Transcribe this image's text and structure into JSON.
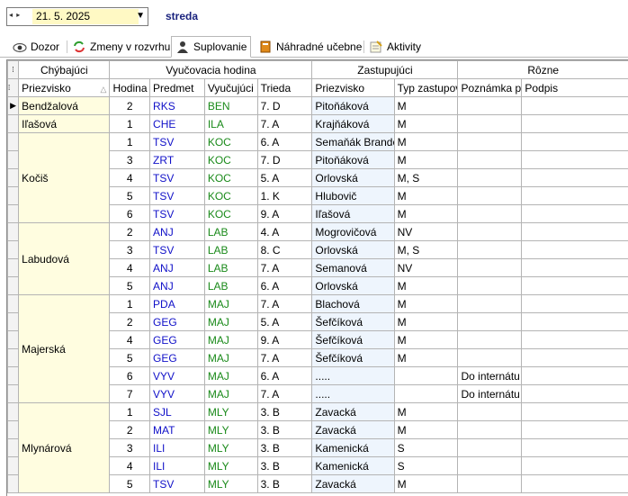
{
  "toolbar": {
    "nav_arrows": "◂ ▸",
    "date": "21. 5. 2025",
    "day_name": "streda"
  },
  "tabs": [
    {
      "label": "Dozor",
      "icon": "eye-icon"
    },
    {
      "label": "Zmeny v rozvrhu",
      "icon": "refresh-icon"
    },
    {
      "label": "Suplovanie",
      "icon": "person-icon"
    },
    {
      "label": "Náhradné učebne",
      "icon": "book-icon"
    },
    {
      "label": "Aktivity",
      "icon": "notepad-icon"
    }
  ],
  "active_tab": "Suplovanie",
  "grid": {
    "groups": [
      "Chýbajúci",
      "Vyučovacia hodina",
      "Zastupujúci",
      "Rôzne"
    ],
    "columns": [
      "Priezvisko",
      "Hodina",
      "Predmet",
      "Vyučujúci",
      "Trieda",
      "Priezvisko",
      "Typ zastupov",
      "Poznámka p",
      "Podpis"
    ],
    "teachers": [
      {
        "name": "Bendžalová",
        "rows": [
          {
            "hodina": "2",
            "predmet": "RKS",
            "vyucujuci": "BEN",
            "trieda": "7. D",
            "zastupujuci": "Pitoňáková",
            "typ": "M",
            "poznamka": "",
            "podpis": ""
          }
        ]
      },
      {
        "name": "Iľašová",
        "rows": [
          {
            "hodina": "1",
            "predmet": "CHE",
            "vyucujuci": "ILA",
            "trieda": "7. A",
            "zastupujuci": "Krajňáková",
            "typ": "M",
            "poznamka": "",
            "podpis": ""
          }
        ]
      },
      {
        "name": "Kočiš",
        "rows": [
          {
            "hodina": "1",
            "predmet": "TSV",
            "vyucujuci": "KOC",
            "trieda": "6. A",
            "zastupujuci": "Semaňák Brando",
            "typ": "M",
            "poznamka": "",
            "podpis": ""
          },
          {
            "hodina": "3",
            "predmet": "ZRT",
            "vyucujuci": "KOC",
            "trieda": "7. D",
            "zastupujuci": "Pitoňáková",
            "typ": "M",
            "poznamka": "",
            "podpis": ""
          },
          {
            "hodina": "4",
            "predmet": "TSV",
            "vyucujuci": "KOC",
            "trieda": "5. A",
            "zastupujuci": "Orlovská",
            "typ": "M, S",
            "poznamka": "",
            "podpis": ""
          },
          {
            "hodina": "5",
            "predmet": "TSV",
            "vyucujuci": "KOC",
            "trieda": "1. K",
            "zastupujuci": "Hlubovič",
            "typ": "M",
            "poznamka": "",
            "podpis": ""
          },
          {
            "hodina": "6",
            "predmet": "TSV",
            "vyucujuci": "KOC",
            "trieda": "9. A",
            "zastupujuci": "Iľašová",
            "typ": "M",
            "poznamka": "",
            "podpis": ""
          }
        ]
      },
      {
        "name": "Labudová",
        "rows": [
          {
            "hodina": "2",
            "predmet": "ANJ",
            "vyucujuci": "LAB",
            "trieda": "4. A",
            "zastupujuci": "Mogrovičová",
            "typ": "NV",
            "poznamka": "",
            "podpis": ""
          },
          {
            "hodina": "3",
            "predmet": "TSV",
            "vyucujuci": "LAB",
            "trieda": "8. C",
            "zastupujuci": "Orlovská",
            "typ": "M, S",
            "poznamka": "",
            "podpis": ""
          },
          {
            "hodina": "4",
            "predmet": "ANJ",
            "vyucujuci": "LAB",
            "trieda": "7. A",
            "zastupujuci": "Semanová",
            "typ": "NV",
            "poznamka": "",
            "podpis": ""
          },
          {
            "hodina": "5",
            "predmet": "ANJ",
            "vyucujuci": "LAB",
            "trieda": "6. A",
            "zastupujuci": "Orlovská",
            "typ": "M",
            "poznamka": "",
            "podpis": ""
          }
        ]
      },
      {
        "name": "Majerská",
        "rows": [
          {
            "hodina": "1",
            "predmet": "PDA",
            "vyucujuci": "MAJ",
            "trieda": "7. A",
            "zastupujuci": "Blachová",
            "typ": "M",
            "poznamka": "",
            "podpis": ""
          },
          {
            "hodina": "2",
            "predmet": "GEG",
            "vyucujuci": "MAJ",
            "trieda": "5. A",
            "zastupujuci": "Šefčíková",
            "typ": "M",
            "poznamka": "",
            "podpis": ""
          },
          {
            "hodina": "4",
            "predmet": "GEG",
            "vyucujuci": "MAJ",
            "trieda": "9. A",
            "zastupujuci": "Šefčíková",
            "typ": "M",
            "poznamka": "",
            "podpis": ""
          },
          {
            "hodina": "5",
            "predmet": "GEG",
            "vyucujuci": "MAJ",
            "trieda": "7. A",
            "zastupujuci": "Šefčíková",
            "typ": "M",
            "poznamka": "",
            "podpis": ""
          },
          {
            "hodina": "6",
            "predmet": "VYV",
            "vyucujuci": "MAJ",
            "trieda": "6. A",
            "zastupujuci": ".....",
            "typ": "",
            "poznamka": "Do internátu",
            "podpis": ""
          },
          {
            "hodina": "7",
            "predmet": "VYV",
            "vyucujuci": "MAJ",
            "trieda": "7. A",
            "zastupujuci": ".....",
            "typ": "",
            "poznamka": "Do internátu",
            "podpis": ""
          }
        ]
      },
      {
        "name": "Mlynárová",
        "rows": [
          {
            "hodina": "1",
            "predmet": "SJL",
            "vyucujuci": "MLY",
            "trieda": "3. B",
            "zastupujuci": "Zavacká",
            "typ": "M",
            "poznamka": "",
            "podpis": ""
          },
          {
            "hodina": "2",
            "predmet": "MAT",
            "vyucujuci": "MLY",
            "trieda": "3. B",
            "zastupujuci": "Zavacká",
            "typ": "M",
            "poznamka": "",
            "podpis": ""
          },
          {
            "hodina": "3",
            "predmet": "ILI",
            "vyucujuci": "MLY",
            "trieda": "3. B",
            "zastupujuci": "Kamenická",
            "typ": "S",
            "poznamka": "",
            "podpis": ""
          },
          {
            "hodina": "4",
            "predmet": "ILI",
            "vyucujuci": "MLY",
            "trieda": "3. B",
            "zastupujuci": "Kamenická",
            "typ": "S",
            "poznamka": "",
            "podpis": ""
          },
          {
            "hodina": "5",
            "predmet": "TSV",
            "vyucujuci": "MLY",
            "trieda": "3. B",
            "zastupujuci": "Zavacká",
            "typ": "M",
            "poznamka": "",
            "podpis": ""
          }
        ]
      }
    ]
  },
  "colors": {
    "subject": "#1010c8",
    "teacher_code": "#1a8a1a",
    "absent_name_bg": "#fffde0",
    "substitute_bg": "#eef5fd",
    "date_bg": "#fff9c4"
  }
}
